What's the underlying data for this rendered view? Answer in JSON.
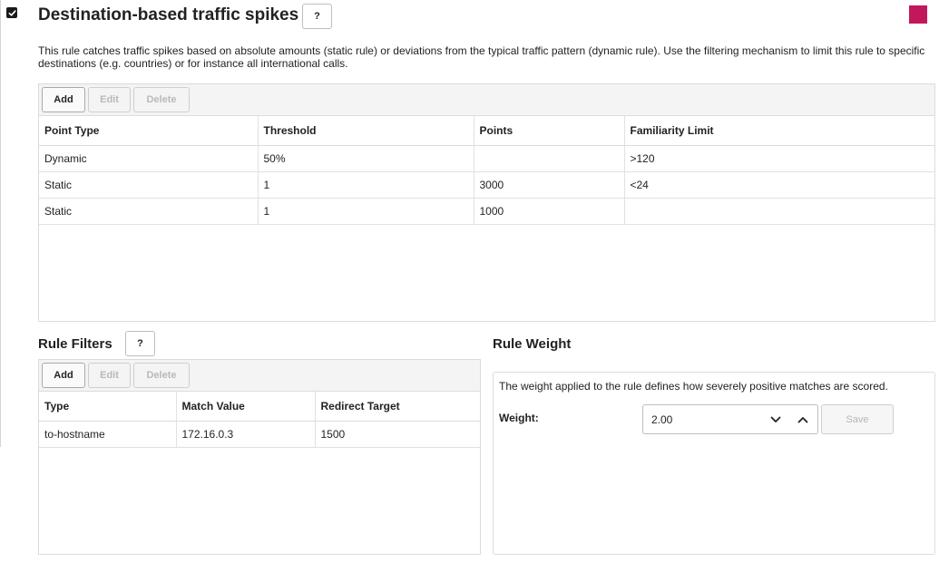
{
  "header": {
    "title": "Destination-based traffic spikes",
    "help_label": "?",
    "enabled": true,
    "swatch_color": "#c2185b"
  },
  "description": "This rule catches traffic spikes based on absolute amounts (static rule) or deviations from the typical traffic pattern (dynamic rule). Use the filtering mechanism to limit this rule to specific destinations (e.g. countries) or for instance all international calls.",
  "points_grid": {
    "toolbar": {
      "add": "Add",
      "edit": "Edit",
      "delete": "Delete"
    },
    "columns": [
      "Point Type",
      "Threshold",
      "Points",
      "Familiarity Limit"
    ],
    "rows": [
      [
        "Dynamic",
        "50%",
        "",
        ">120"
      ],
      [
        "Static",
        "1",
        "3000",
        "<24"
      ],
      [
        "Static",
        "1",
        "1000",
        ""
      ]
    ]
  },
  "rule_filters": {
    "title": "Rule Filters",
    "help_label": "?",
    "toolbar": {
      "add": "Add",
      "edit": "Edit",
      "delete": "Delete"
    },
    "columns": [
      "Type",
      "Match Value",
      "Redirect Target"
    ],
    "rows": [
      [
        "to-hostname",
        "172.16.0.3",
        "1500"
      ]
    ]
  },
  "rule_weight": {
    "title": "Rule Weight",
    "description": "The weight applied to the rule defines how severely positive matches are scored.",
    "label": "Weight:",
    "value": "2.00",
    "save": "Save"
  }
}
